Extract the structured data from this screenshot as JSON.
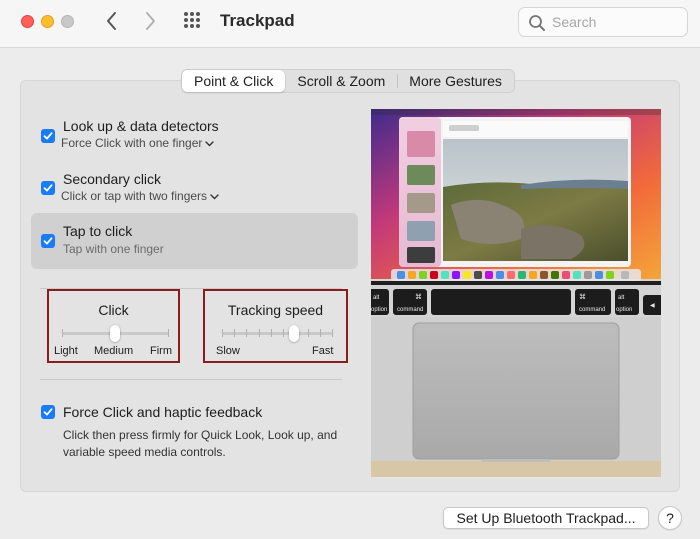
{
  "window": {
    "title": "Trackpad",
    "search_placeholder": "Search"
  },
  "tabs": [
    {
      "label": "Point & Click",
      "active": true
    },
    {
      "label": "Scroll & Zoom",
      "active": false
    },
    {
      "label": "More Gestures",
      "active": false
    }
  ],
  "options": [
    {
      "title": "Look up & data detectors",
      "subtitle": "Force Click with one finger",
      "checked": true,
      "has_dropdown": true
    },
    {
      "title": "Secondary click",
      "subtitle": "Click or tap with two fingers",
      "checked": true,
      "has_dropdown": true
    },
    {
      "title": "Tap to click",
      "subtitle": "Tap with one finger",
      "checked": true,
      "has_dropdown": false,
      "highlighted": true
    }
  ],
  "click_slider": {
    "title": "Click",
    "labels": [
      "Light",
      "Medium",
      "Firm"
    ],
    "steps": 3,
    "value_index": 1
  },
  "tracking_slider": {
    "title": "Tracking speed",
    "min_label": "Slow",
    "max_label": "Fast",
    "ticks": 10,
    "value_fraction": 0.65
  },
  "force_click": {
    "title": "Force Click and haptic feedback",
    "description": "Click then press firmly for Quick Look, Look up, and variable speed media controls.",
    "checked": true
  },
  "preview_keys": {
    "left_alt": "alt",
    "left_option": "option",
    "left_command": "command",
    "right_command": "command",
    "right_alt": "alt",
    "right_option": "option"
  },
  "buttons": {
    "setup_bluetooth": "Set Up Bluetooth Trackpad...",
    "help": "?"
  },
  "colors": {
    "accent": "#1a7cf5",
    "highlight_box": "#8a1c1c",
    "close": "#fe5f57",
    "minimize": "#febc2e"
  }
}
